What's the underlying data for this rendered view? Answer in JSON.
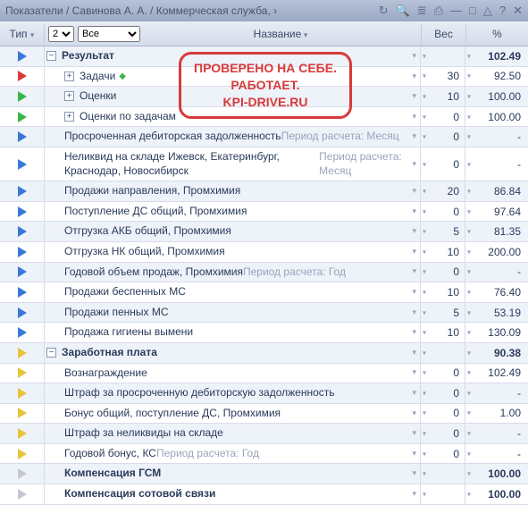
{
  "titlebar": {
    "breadcrumb": "Показатели / Савинова А. А. / Коммерческая служба, ›"
  },
  "toolbar": {
    "type_label": "Тип",
    "select1": "2",
    "select2": "Все",
    "name_label": "Название",
    "weight_label": "Вес",
    "pct_label": "%"
  },
  "stamp": {
    "line1": "ПРОВЕРЕНО НА СЕБЕ.",
    "line2": "РАБОТАЕТ.",
    "line3": "KPI-DRIVE.RU"
  },
  "rows": [
    {
      "arrow": "blue",
      "indent": 0,
      "toggle": "−",
      "name": "Результат",
      "bold": true,
      "weight": "",
      "pct": "102.49",
      "pctbold": true
    },
    {
      "arrow": "red",
      "indent": 1,
      "toggle": "+",
      "name": "Задачи",
      "diamond": true,
      "weight": "30",
      "pct": "92.50"
    },
    {
      "arrow": "green",
      "indent": 1,
      "toggle": "+",
      "name": "Оценки",
      "weight": "10",
      "pct": "100.00"
    },
    {
      "arrow": "green",
      "indent": 1,
      "toggle": "+",
      "name": "Оценки по задачам",
      "weight": "0",
      "pct": "100.00"
    },
    {
      "arrow": "blue",
      "indent": 1,
      "name": "Просроченная дебиторская задолженность",
      "period": "Период расчета: Месяц",
      "weight": "0",
      "pct": "-"
    },
    {
      "arrow": "blue",
      "indent": 1,
      "name": "Неликвид на складе Ижевск, Екатеринбург, Краснодар, Новосибирск",
      "period": "Период расчета: Месяц",
      "weight": "0",
      "pct": "-"
    },
    {
      "arrow": "blue",
      "indent": 1,
      "name": "Продажи направления, Промхимия",
      "weight": "20",
      "pct": "86.84"
    },
    {
      "arrow": "blue",
      "indent": 1,
      "name": "Поступление ДС общий, Промхимия",
      "weight": "0",
      "pct": "97.64"
    },
    {
      "arrow": "blue",
      "indent": 1,
      "name": "Отгрузка АКБ общий, Промхимия",
      "weight": "5",
      "pct": "81.35"
    },
    {
      "arrow": "blue",
      "indent": 1,
      "name": "Отгрузка НК общий, Промхимия",
      "weight": "10",
      "pct": "200.00"
    },
    {
      "arrow": "blue",
      "indent": 1,
      "name": "Годовой объем продаж, Промхимия",
      "period": "Период расчета: Год",
      "weight": "0",
      "pct": "-"
    },
    {
      "arrow": "blue",
      "indent": 1,
      "name": "Продажи беспенных МС",
      "weight": "10",
      "pct": "76.40"
    },
    {
      "arrow": "blue",
      "indent": 1,
      "name": "Продажи пенных МС",
      "weight": "5",
      "pct": "53.19"
    },
    {
      "arrow": "blue",
      "indent": 1,
      "name": "Продажа гигиены вымени",
      "weight": "10",
      "pct": "130.09"
    },
    {
      "arrow": "yellow",
      "indent": 0,
      "toggle": "−",
      "name": "Заработная плата",
      "bold": true,
      "weight": "",
      "pct": "90.38",
      "pctbold": true
    },
    {
      "arrow": "yellow",
      "indent": 1,
      "name": "Вознаграждение",
      "weight": "0",
      "pct": "102.49"
    },
    {
      "arrow": "yellow",
      "indent": 1,
      "name": "Штраф за просроченную дебиторскую задолженность",
      "weight": "0",
      "pct": "-"
    },
    {
      "arrow": "yellow",
      "indent": 1,
      "name": "Бонус общий, поступление ДС, Промхимия",
      "weight": "0",
      "pct": "1.00"
    },
    {
      "arrow": "yellow",
      "indent": 1,
      "name": "Штраф за неликвиды на складе",
      "weight": "0",
      "pct": "-"
    },
    {
      "arrow": "yellow",
      "indent": 1,
      "name": "Годовой бонус, КС",
      "period": "Период расчета: Год",
      "weight": "0",
      "pct": "-"
    },
    {
      "arrow": "grey",
      "indent": 1,
      "name": "Компенсация ГСМ",
      "bold": true,
      "weight": "",
      "pct": "100.00",
      "pctbold": true
    },
    {
      "arrow": "grey",
      "indent": 1,
      "name": "Компенсация сотовой связи",
      "bold": true,
      "weight": "",
      "pct": "100.00",
      "pctbold": true
    }
  ]
}
